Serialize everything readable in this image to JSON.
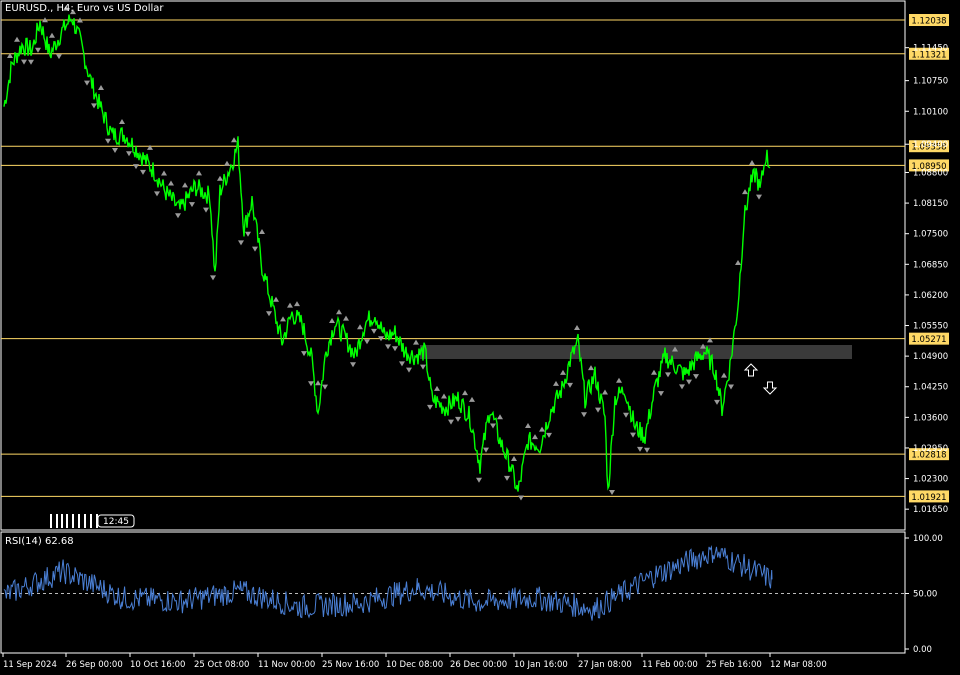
{
  "header": {
    "symbol": "EURUSD.",
    "timeframe": "H4",
    "description": "Euro vs US Dollar",
    "title": "EURUSD., H4:  Euro vs US Dollar"
  },
  "price_axis": {
    "ticks": [
      "1.11450",
      "1.10750",
      "1.10100",
      "1.09400",
      "1.08800",
      "1.08150",
      "1.07500",
      "1.06850",
      "1.06200",
      "1.05550",
      "1.04900",
      "1.04250",
      "1.03600",
      "1.02950",
      "1.02300",
      "1.01650"
    ]
  },
  "horizontal_levels": [
    {
      "label": "1.12038",
      "price": 1.12038
    },
    {
      "label": "1.11321",
      "price": 1.11321
    },
    {
      "label": "1.09358",
      "price": 1.09358
    },
    {
      "label": "1.08950",
      "price": 1.0895
    },
    {
      "label": "1.05271",
      "price": 1.05271
    },
    {
      "label": "1.02818",
      "price": 1.02818
    },
    {
      "label": "1.01921",
      "price": 1.01921
    }
  ],
  "rsi": {
    "title": "RSI(14) 62.68",
    "ticks": [
      "100.00",
      "50.00",
      "0.00"
    ],
    "level": 50
  },
  "time_axis": {
    "labels": [
      "11 Sep 2024",
      "26 Sep 00:00",
      "10 Oct 16:00",
      "25 Oct 08:00",
      "11 Nov 00:00",
      "25 Nov 16:00",
      "10 Dec 08:00",
      "26 Dec 00:00",
      "10 Jan 16:00",
      "27 Jan 08:00",
      "11 Feb 00:00",
      "25 Feb 16:00",
      "12 Mar 08:00"
    ]
  },
  "time_marker": "12:45",
  "colors": {
    "background": "#000000",
    "price_line": "#00ff00",
    "level_line": "#ffd966",
    "level_tag": "#ffd966",
    "rsi_line": "#4a7fd4",
    "zone": "#3a3a3a",
    "fractal": "#9a9a9a",
    "axis": "#ffffff"
  },
  "icons": [
    "up-arrow-icon",
    "down-arrow-icon"
  ],
  "chart_data": {
    "type": "line",
    "title": "EURUSD., H4:  Euro vs US Dollar",
    "x": [
      "11 Sep 2024",
      "26 Sep 00:00",
      "10 Oct 16:00",
      "25 Oct 08:00",
      "11 Nov 00:00",
      "25 Nov 16:00",
      "10 Dec 08:00",
      "26 Dec 00:00",
      "10 Jan 16:00",
      "27 Jan 08:00",
      "11 Feb 00:00",
      "25 Feb 16:00",
      "12 Mar 08:00"
    ],
    "series": [
      {
        "values": [
          1.102,
          1.12,
          1.101,
          1.098,
          1.087,
          1.06,
          1.048,
          1.033,
          1.03,
          1.038,
          1.034,
          1.041,
          1.088
        ]
      }
    ],
    "ylim": [
      1.013,
      1.124
    ],
    "rsi": {
      "ylim": [
        0,
        100
      ],
      "values": [
        48,
        70,
        46,
        43,
        52,
        38,
        41,
        55,
        42,
        46,
        36,
        66,
        88,
        62.68
      ]
    }
  }
}
